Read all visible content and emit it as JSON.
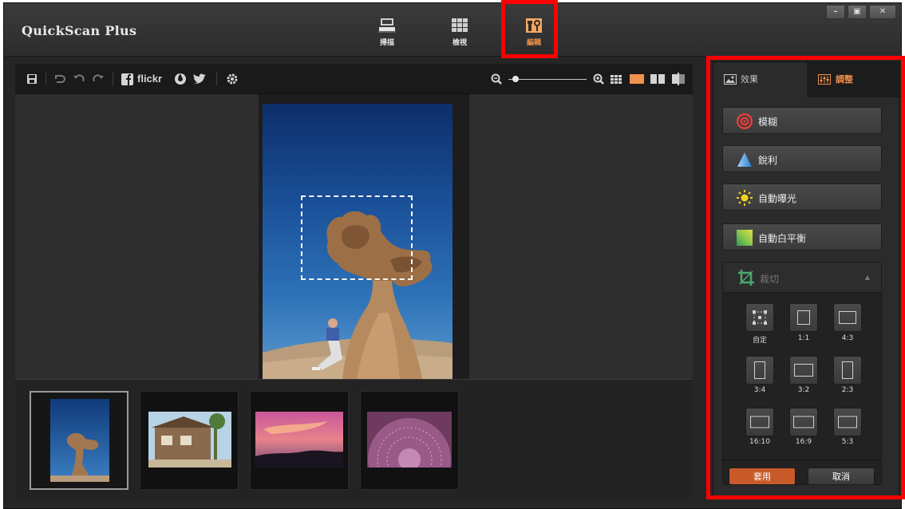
{
  "app": {
    "title": "QuickScan Plus"
  },
  "mode_tabs": [
    {
      "label": "掃描",
      "icon": "scanner-icon"
    },
    {
      "label": "檢視",
      "icon": "grid-view-icon"
    },
    {
      "label": "編輯",
      "icon": "edit-tools-icon",
      "active": true
    }
  ],
  "window_controls": {
    "minimize": "–",
    "maximize": "▣",
    "close": "✕"
  },
  "toolbar": {
    "icons": [
      "save-icon",
      "undo-all-icon",
      "undo-icon",
      "redo-icon",
      "facebook-icon",
      "flickr-icon",
      "picasa-icon",
      "twitter-icon",
      "settings-icon",
      "zoom-out-icon",
      "zoom-in-icon",
      "grid-layout-icon",
      "single-view-icon",
      "side-by-side-icon",
      "split-compare-icon"
    ],
    "flickr_text": "flickr",
    "zoom_level": 0.05
  },
  "thumbnails": [
    {
      "name": "queens-head-rock",
      "selected": true
    },
    {
      "name": "wooden-house"
    },
    {
      "name": "sunset-sky"
    },
    {
      "name": "purple-flower"
    }
  ],
  "panel": {
    "tabs": [
      {
        "label": "效果",
        "icon": "image-effect-icon"
      },
      {
        "label": "調整",
        "icon": "adjust-sliders-icon",
        "active": true
      }
    ],
    "tools": [
      {
        "label": "模糊",
        "icon": "blur-target-icon"
      },
      {
        "label": "銳利",
        "icon": "sharpen-triangle-icon"
      },
      {
        "label": "自動曝光",
        "icon": "sun-exposure-icon"
      },
      {
        "label": "自動白平衡",
        "icon": "white-balance-icon"
      }
    ],
    "crop": {
      "label": "裁切",
      "icon": "crop-icon",
      "ratios": [
        "自定",
        "1:1",
        "4:3",
        "3:4",
        "3:2",
        "2:3",
        "16:10",
        "16:9",
        "5:3"
      ],
      "apply_label": "套用",
      "cancel_label": "取消"
    }
  },
  "colors": {
    "accent": "#f0914d",
    "highlight_box": "#ff0000",
    "apply_button": "#c85a2a"
  }
}
